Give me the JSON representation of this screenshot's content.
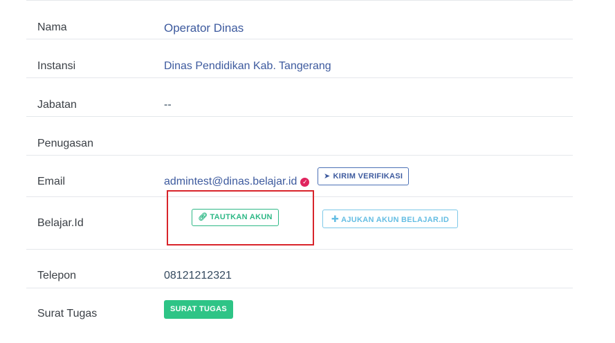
{
  "profile": {
    "nama": {
      "label": "Nama",
      "value": "Operator Dinas"
    },
    "instansi": {
      "label": "Instansi",
      "value": "Dinas Pendidikan Kab. Tangerang"
    },
    "jabatan": {
      "label": "Jabatan",
      "value": "--"
    },
    "penugasan": {
      "label": "Penugasan",
      "value": ""
    },
    "email": {
      "label": "Email",
      "value": "admintest@dinas.belajar.id",
      "verified_icon": "check-circle-icon",
      "kirim_label": "KIRIM VERIFIKASI",
      "kirim_icon": "paper-plane-icon"
    },
    "belajar_id": {
      "label": "Belajar.Id",
      "tautkan_label": "TAUTKAN AKUN",
      "tautkan_icon": "link-icon",
      "ajukan_label": "AJUKAN AKUN BELAJAR.ID",
      "ajukan_icon": "plus-icon"
    },
    "telepon": {
      "label": "Telepon",
      "value": "08121212321"
    },
    "surat_tugas": {
      "label": "Surat Tugas",
      "button_label": "SURAT TUGAS"
    }
  },
  "colors": {
    "link_blue": "#3d5a9e",
    "green": "#2eb886",
    "light_blue": "#64bde3",
    "highlight_red": "#d8232a",
    "verified_pink": "#e0245e"
  }
}
